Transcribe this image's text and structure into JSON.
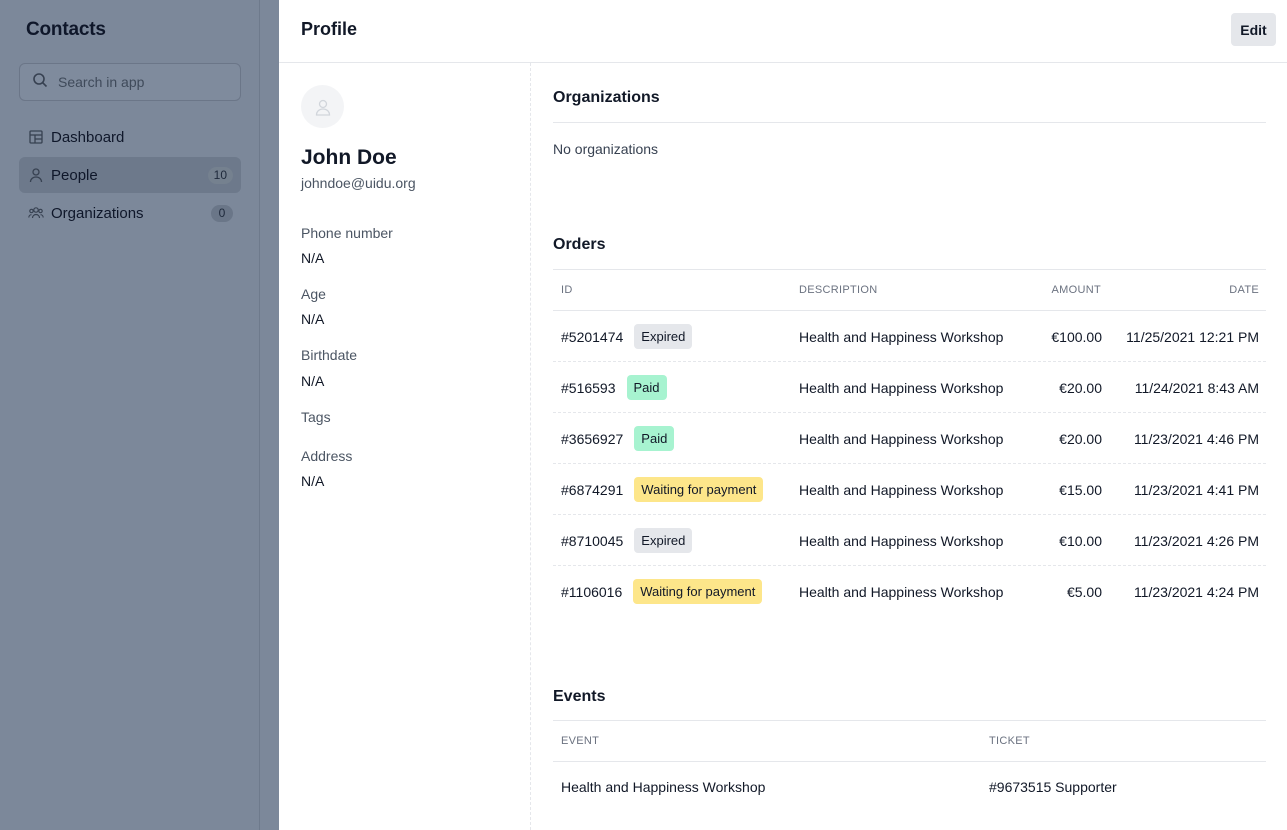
{
  "sidebar": {
    "title": "Contacts",
    "search_placeholder": "Search in app",
    "items": [
      {
        "label": "Dashboard",
        "icon": "dashboard-icon"
      },
      {
        "label": "People",
        "icon": "person-icon",
        "count": "10",
        "active": true
      },
      {
        "label": "Organizations",
        "icon": "users-icon",
        "count": "0"
      }
    ]
  },
  "header": {
    "title": "Profile",
    "edit_label": "Edit"
  },
  "profile": {
    "name": "John Doe",
    "email": "johndoe@uidu.org",
    "fields": [
      {
        "label": "Phone number",
        "value": "N/A"
      },
      {
        "label": "Age",
        "value": "N/A"
      },
      {
        "label": "Birthdate",
        "value": "N/A"
      },
      {
        "label": "Tags",
        "value": ""
      },
      {
        "label": "Address",
        "value": "N/A"
      }
    ]
  },
  "organizations": {
    "title": "Organizations",
    "empty_text": "No organizations"
  },
  "orders": {
    "title": "Orders",
    "columns": {
      "id": "ID",
      "description": "DESCRIPTION",
      "amount": "AMOUNT",
      "date": "DATE"
    },
    "rows": [
      {
        "id": "#5201474",
        "status": "Expired",
        "status_type": "expired",
        "description": "Health and Happiness Workshop",
        "amount": "€100.00",
        "date": "11/25/2021 12:21 PM"
      },
      {
        "id": "#516593",
        "status": "Paid",
        "status_type": "paid",
        "description": "Health and Happiness Workshop",
        "amount": "€20.00",
        "date": "11/24/2021 8:43 AM"
      },
      {
        "id": "#3656927",
        "status": "Paid",
        "status_type": "paid",
        "description": "Health and Happiness Workshop",
        "amount": "€20.00",
        "date": "11/23/2021 4:46 PM"
      },
      {
        "id": "#6874291",
        "status": "Waiting for payment",
        "status_type": "waiting",
        "description": "Health and Happiness Workshop",
        "amount": "€15.00",
        "date": "11/23/2021 4:41 PM"
      },
      {
        "id": "#8710045",
        "status": "Expired",
        "status_type": "expired",
        "description": "Health and Happiness Workshop",
        "amount": "€10.00",
        "date": "11/23/2021 4:26 PM"
      },
      {
        "id": "#1106016",
        "status": "Waiting for payment",
        "status_type": "waiting",
        "description": "Health and Happiness Workshop",
        "amount": "€5.00",
        "date": "11/23/2021 4:24 PM"
      }
    ]
  },
  "events": {
    "title": "Events",
    "columns": {
      "event": "EVENT",
      "ticket": "TICKET"
    },
    "rows": [
      {
        "event": "Health and Happiness Workshop",
        "ticket": "#9673515 Supporter"
      }
    ]
  },
  "colors": {
    "sidebar_bg": "#7c889a",
    "badge_expired": "#e5e7eb",
    "badge_paid": "#a7f3d0",
    "badge_waiting": "#fde68a"
  }
}
